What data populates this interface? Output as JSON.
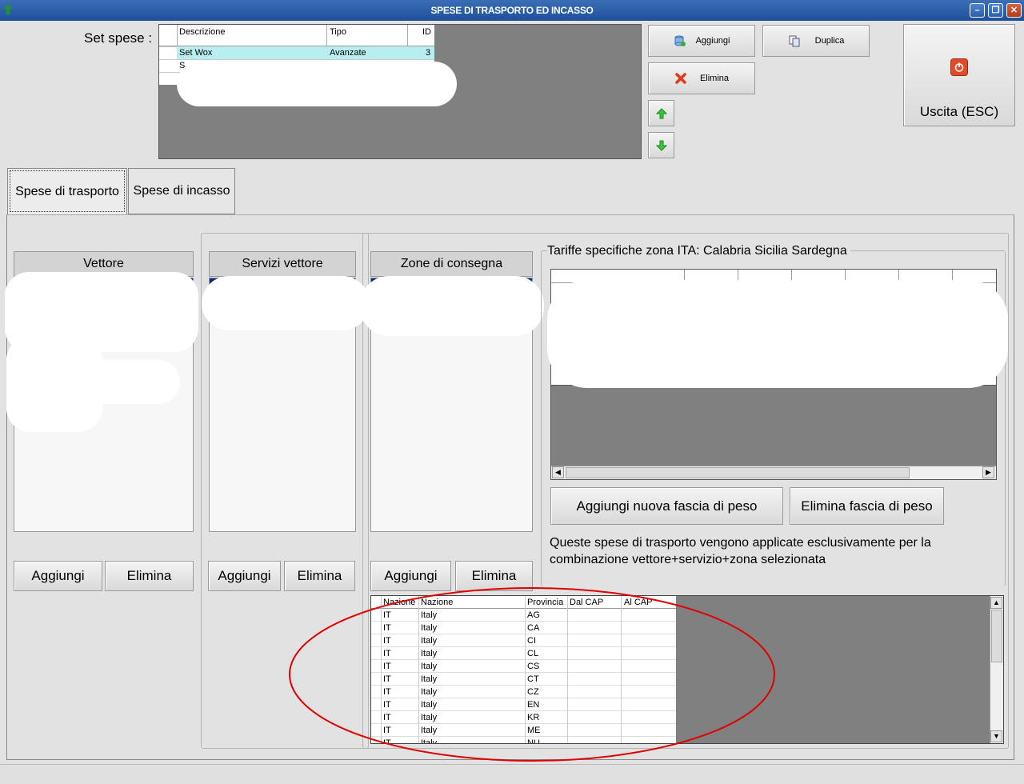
{
  "window": {
    "title": "SPESE DI TRASPORTO ED INCASSO",
    "controls": {
      "minimize": "–",
      "restore": "❐",
      "close": "✕"
    }
  },
  "set_spese": {
    "label": "Set spese :",
    "columns": [
      "Descrizione",
      "Tipo",
      "ID"
    ],
    "rows": [
      {
        "descrizione": "Set Wox",
        "tipo": "Avanzate",
        "id": "3"
      },
      {
        "descrizione": "S",
        "tipo": "",
        "id": ""
      }
    ]
  },
  "toolbar": {
    "aggiungi": "Aggiungi",
    "duplica": "Duplica",
    "elimina": "Elimina",
    "uscita": "Uscita (ESC)"
  },
  "tabs": [
    {
      "label": "Spese di trasporto",
      "active": true
    },
    {
      "label": "Spese di incasso",
      "active": false
    }
  ],
  "columns": {
    "vettore": {
      "title": "Vettore",
      "add": "Aggiungi",
      "remove": "Elimina"
    },
    "servizi": {
      "title": "Servizi vettore",
      "add": "Aggiungi",
      "remove": "Elimina"
    },
    "zone": {
      "title": "Zone di consegna",
      "add": "Aggiungi",
      "remove": "Elimina"
    }
  },
  "tariffe": {
    "title": "Tariffe specifiche zona ITA: Calabria Sicilia Sardegna",
    "add_band": "Aggiungi nuova fascia di peso",
    "remove_band": "Elimina fascia di peso",
    "description": "Queste spese di trasporto vengono applicate esclusivamente per la combinazione vettore+servizio+zona selezionata"
  },
  "zone_table": {
    "columns": [
      "Nazione",
      "Nazione",
      "Provincia",
      "Dal CAP",
      "Al CAP"
    ],
    "rows": [
      [
        "IT",
        "Italy",
        "AG",
        "",
        ""
      ],
      [
        "IT",
        "Italy",
        "CA",
        "",
        ""
      ],
      [
        "IT",
        "Italy",
        "CI",
        "",
        ""
      ],
      [
        "IT",
        "Italy",
        "CL",
        "",
        ""
      ],
      [
        "IT",
        "Italy",
        "CS",
        "",
        ""
      ],
      [
        "IT",
        "Italy",
        "CT",
        "",
        ""
      ],
      [
        "IT",
        "Italy",
        "CZ",
        "",
        ""
      ],
      [
        "IT",
        "Italy",
        "EN",
        "",
        ""
      ],
      [
        "IT",
        "Italy",
        "KR",
        "",
        ""
      ],
      [
        "IT",
        "Italy",
        "ME",
        "",
        ""
      ],
      [
        "IT",
        "Italy",
        "NU",
        "",
        ""
      ]
    ]
  },
  "colors": {
    "titlebar": "#2a5fab",
    "selected_row": "#b9eef0",
    "annotation": "#e00000",
    "grid_bg": "#808080"
  }
}
